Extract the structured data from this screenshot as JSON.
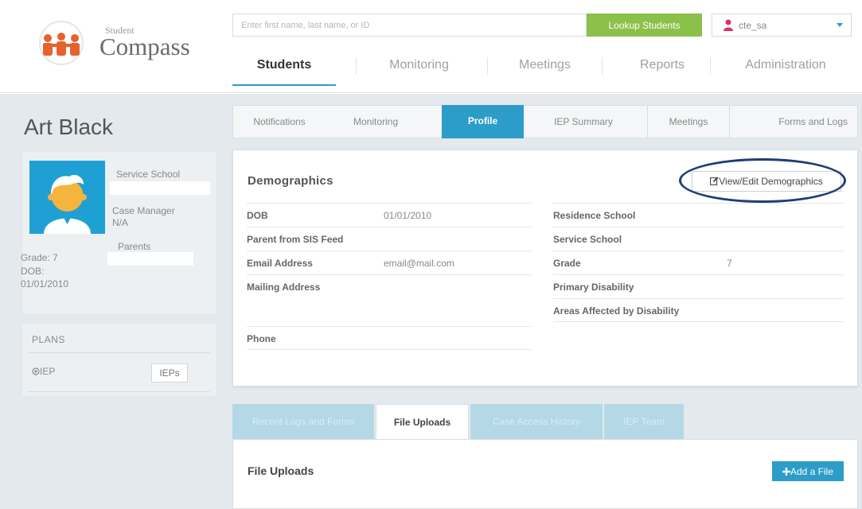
{
  "brand": {
    "small": "Student",
    "name": "Compass"
  },
  "search": {
    "placeholder": "Enter first name, last name, or ID"
  },
  "lookup_label": "Lookup Students",
  "user": {
    "name": "cte_sa"
  },
  "main_nav": [
    "Students",
    "Monitoring",
    "Meetings",
    "Reports",
    "Administration"
  ],
  "student": {
    "name": "Art Black",
    "service_school_label": "Service School",
    "case_manager_label": "Case Manager",
    "case_manager_value": "N/A",
    "parents_label": "Parents",
    "grade": "Grade: 7",
    "dob_label": "DOB:",
    "dob": "01/01/2010"
  },
  "plans": {
    "title": "PLANS",
    "item": "IEP",
    "button": "IEPs"
  },
  "profile_tabs": [
    "Notifications",
    "Monitoring",
    "Profile",
    "IEP Summary",
    "Meetings",
    "Forms and Logs"
  ],
  "demographics": {
    "title": "Demographics",
    "edit_button": "View/Edit Demographics",
    "left": [
      {
        "label": "DOB",
        "value": "01/01/2010"
      },
      {
        "label": "Parent from SIS Feed",
        "value": ""
      },
      {
        "label": "Email Address",
        "value": "email@mail.com"
      },
      {
        "label": "Mailing Address",
        "value": ""
      },
      {
        "label": "Phone",
        "value": ""
      }
    ],
    "right": [
      {
        "label": "Residence School",
        "value": ""
      },
      {
        "label": "Service School",
        "value": ""
      },
      {
        "label": "Grade",
        "value": "7"
      },
      {
        "label": "Primary Disability",
        "value": ""
      },
      {
        "label": "Areas Affected by Disability",
        "value": ""
      }
    ]
  },
  "lower_tabs": [
    "Recent Logs and Forms",
    "File Uploads",
    "Case Access History",
    "IEP Team"
  ],
  "uploads": {
    "title": "File Uploads",
    "add_button": "Add a File"
  },
  "colors": {
    "accent": "#2c9cc9",
    "lookup": "#8bc04a",
    "highlight": "#1f3c7a",
    "avatar": "#1fa0d5"
  }
}
